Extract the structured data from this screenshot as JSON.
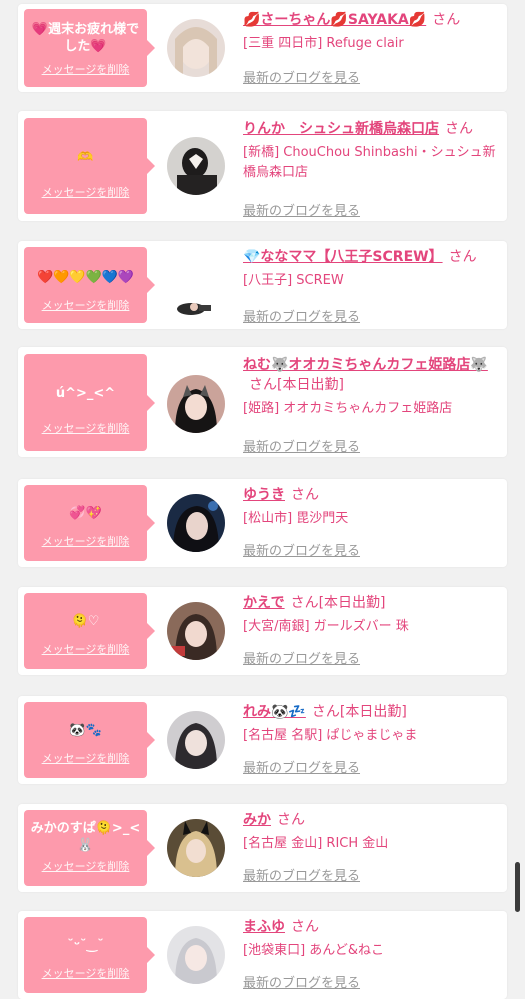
{
  "delete_label": "メッセージを削除",
  "blog_label": "最新のブログを見る",
  "san_label": "さん",
  "accent": "#e3457c",
  "bubble_color": "#fd9aac",
  "entries": [
    {
      "message": "💗週末お疲れ様でした💗",
      "name": "💋さーちゃん💋SAYAKA💋",
      "status": "",
      "shop": "[三重 四日市] Refuge clair"
    },
    {
      "message": "🫶",
      "name": "りんか　シュシュ新橋烏森口店",
      "status": "",
      "shop": "[新橋] ChouChou Shinbashi・シュシュ新橋烏森口店"
    },
    {
      "message": "❤️🧡💛💚💙💜",
      "name": "💎ななママ【八王子SCREW】",
      "status": "",
      "shop": "[八王子] SCREW"
    },
    {
      "message": "ú^>_<^",
      "name": "ねむ🐺オオカミちゃんカフェ姫路店🐺",
      "status": "[本日出勤]",
      "shop": "[姫路] オオカミちゃんカフェ姫路店"
    },
    {
      "message": "💞💖",
      "name": "ゆうき",
      "status": "",
      "shop": "[松山市] 毘沙門天"
    },
    {
      "message": "🫠♡",
      "name": "かえで",
      "status": "[本日出勤]",
      "shop": "[大宮/南銀] ガールズバー 珠"
    },
    {
      "message": "🐼🐾",
      "name": "れみ🐼💤",
      "status": "[本日出勤]",
      "shop": "[名古屋 名駅] ぱじゃまじゃま"
    },
    {
      "message": "みかのすぱ🫠>_<🐰",
      "name": "みか",
      "status": "",
      "shop": "[名古屋 金山] RICH 金山"
    },
    {
      "message": "˘ᵕ˘‿˘",
      "name": "まふゆ",
      "status": "",
      "shop": "[池袋東口] あんど&ねこ"
    }
  ]
}
